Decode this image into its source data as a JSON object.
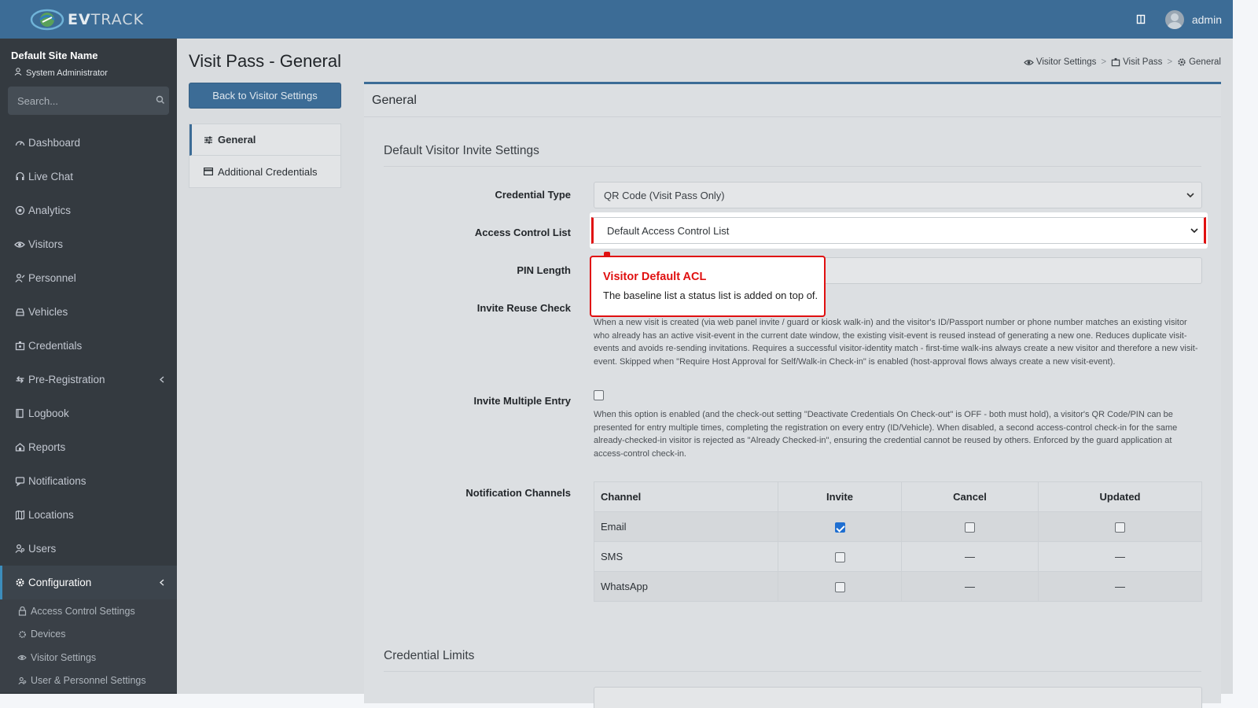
{
  "brand": {
    "name_bold": "EV",
    "name_rest": "TRACK"
  },
  "topbar": {
    "user_name": "admin"
  },
  "sidebar": {
    "site_name": "Default Site Name",
    "role": "System Administrator",
    "search_placeholder": "Search...",
    "items": [
      {
        "label": "Dashboard",
        "icon": "dashboard-icon"
      },
      {
        "label": "Live Chat",
        "icon": "headset-icon"
      },
      {
        "label": "Analytics",
        "icon": "analytics-icon"
      },
      {
        "label": "Visitors",
        "icon": "eye-icon"
      },
      {
        "label": "Personnel",
        "icon": "personnel-icon"
      },
      {
        "label": "Vehicles",
        "icon": "car-icon"
      },
      {
        "label": "Credentials",
        "icon": "badge-icon"
      },
      {
        "label": "Pre-Registration",
        "icon": "exchange-icon"
      },
      {
        "label": "Logbook",
        "icon": "book-icon"
      },
      {
        "label": "Reports",
        "icon": "chart-icon"
      },
      {
        "label": "Notifications",
        "icon": "bell-icon"
      },
      {
        "label": "Locations",
        "icon": "map-icon"
      },
      {
        "label": "Users",
        "icon": "users-icon"
      },
      {
        "label": "Configuration",
        "icon": "gear-icon"
      }
    ],
    "config_sub": [
      {
        "label": "Access Control Settings",
        "icon": "lock-icon"
      },
      {
        "label": "Devices",
        "icon": "device-icon"
      },
      {
        "label": "Visitor Settings",
        "icon": "eye-icon"
      },
      {
        "label": "User & Personnel Settings",
        "icon": "users-icon"
      }
    ]
  },
  "page": {
    "title": "Visit Pass - General",
    "breadcrumb": [
      "Visitor Settings",
      "Visit Pass",
      "General"
    ],
    "back_button": "Back to Visitor Settings",
    "side_menu": [
      "General",
      "Additional Credentials"
    ]
  },
  "card": {
    "header": "General",
    "section1": "Default Visitor Invite Settings",
    "section2": "Credential Limits",
    "credential_type": {
      "label": "Credential Type",
      "value": "QR Code (Visit Pass Only)"
    },
    "acl": {
      "label": "Access Control List",
      "value": "Default Access Control List"
    },
    "pin_length": {
      "label": "PIN Length"
    },
    "invite_reuse": {
      "label": "Invite Reuse Check",
      "help": "When a new visit is created (via web panel invite / guard or kiosk walk-in) and the visitor's ID/Passport number or phone number matches an existing visitor who already has an active visit-event in the current date window, the existing visit-event is reused instead of generating a new one. Reduces duplicate visit-events and avoids re-sending invitations. Requires a successful visitor-identity match - first-time walk-ins always create a new visitor and therefore a new visit-event. Skipped when \"Require Host Approval for Self/Walk-in Check-in\" is enabled (host-approval flows always create a new visit-event)."
    },
    "invite_multiple": {
      "label": "Invite Multiple Entry",
      "help": "When this option is enabled (and the check-out setting \"Deactivate Credentials On Check-out\" is OFF - both must hold), a visitor's QR Code/PIN can be presented for entry multiple times, completing the registration on every entry (ID/Vehicle). When disabled, a second access-control check-in for the same already-checked-in visitor is rejected as \"Already Checked-in\", ensuring the credential cannot be reused by others. Enforced by the guard application at access-control check-in."
    },
    "notification_channels": {
      "label": "Notification Channels",
      "headers": [
        "Channel",
        "Invite",
        "Cancel",
        "Updated"
      ],
      "rows": [
        {
          "channel": "Email",
          "invite": true,
          "cancel": false,
          "updated": false,
          "cancel_dash": false
        },
        {
          "channel": "SMS",
          "invite": false,
          "cancel_dash": true,
          "dash": "—"
        },
        {
          "channel": "WhatsApp",
          "invite": false,
          "cancel_dash": true,
          "dash": "—"
        }
      ]
    }
  },
  "tooltip": {
    "title": "Visitor Default ACL",
    "body": "The baseline list a status list is added on top of."
  },
  "colors": {
    "accent": "#3c6c96",
    "highlight_red": "#e01010",
    "sidebar_bg": "#343a40"
  }
}
